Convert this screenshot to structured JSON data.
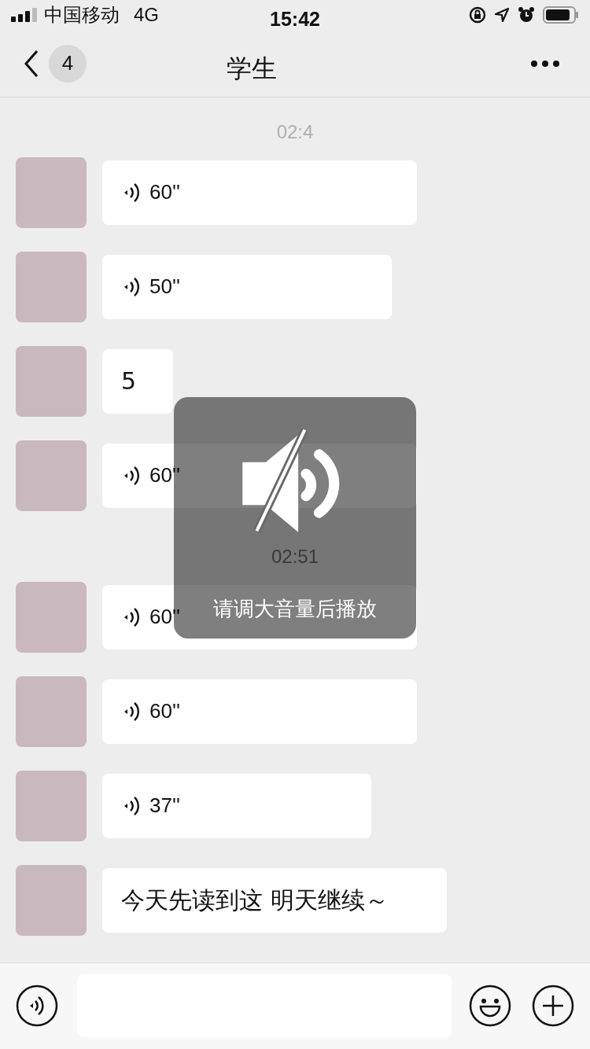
{
  "status_bar": {
    "carrier": "中国移动",
    "network": "4G",
    "time": "15:42"
  },
  "nav": {
    "unread": "4",
    "title": "学生"
  },
  "messages": [
    {
      "kind": "time",
      "text": "02:4"
    },
    {
      "kind": "voice",
      "duration": "60''"
    },
    {
      "kind": "voice",
      "duration": "50''"
    },
    {
      "kind": "text",
      "text": "5"
    },
    {
      "kind": "voice",
      "duration": "60''"
    },
    {
      "kind": "time",
      "text": "02:51"
    },
    {
      "kind": "voice",
      "duration": "60''"
    },
    {
      "kind": "voice",
      "duration": "60''"
    },
    {
      "kind": "voice",
      "duration": "37''"
    },
    {
      "kind": "text",
      "text": "今天先读到这 明天继续～"
    }
  ],
  "toast": {
    "text": "请调大音量后播放"
  }
}
